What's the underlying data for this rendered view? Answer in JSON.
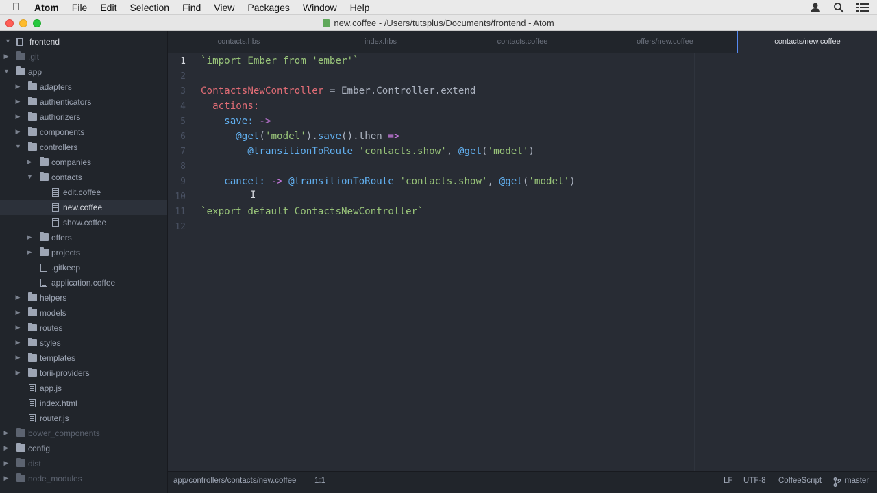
{
  "menubar": {
    "app_name": "Atom",
    "items": [
      "File",
      "Edit",
      "Selection",
      "Find",
      "View",
      "Packages",
      "Window",
      "Help"
    ]
  },
  "window": {
    "title": "new.coffee - /Users/tutsplus/Documents/frontend - Atom"
  },
  "tree": {
    "project": "frontend",
    "items": [
      {
        "label": ".git",
        "kind": "folder",
        "depth": 1,
        "expanded": false,
        "dim": true
      },
      {
        "label": "app",
        "kind": "folder",
        "depth": 1,
        "expanded": true
      },
      {
        "label": "adapters",
        "kind": "folder",
        "depth": 2,
        "expanded": false
      },
      {
        "label": "authenticators",
        "kind": "folder",
        "depth": 2,
        "expanded": false
      },
      {
        "label": "authorizers",
        "kind": "folder",
        "depth": 2,
        "expanded": false
      },
      {
        "label": "components",
        "kind": "folder",
        "depth": 2,
        "expanded": false
      },
      {
        "label": "controllers",
        "kind": "folder",
        "depth": 2,
        "expanded": true
      },
      {
        "label": "companies",
        "kind": "folder",
        "depth": 3,
        "expanded": false
      },
      {
        "label": "contacts",
        "kind": "folder",
        "depth": 3,
        "expanded": true
      },
      {
        "label": "edit.coffee",
        "kind": "file",
        "depth": 4
      },
      {
        "label": "new.coffee",
        "kind": "file",
        "depth": 4,
        "selected": true
      },
      {
        "label": "show.coffee",
        "kind": "file",
        "depth": 4
      },
      {
        "label": "offers",
        "kind": "folder",
        "depth": 3,
        "expanded": false
      },
      {
        "label": "projects",
        "kind": "folder",
        "depth": 3,
        "expanded": false
      },
      {
        "label": ".gitkeep",
        "kind": "file",
        "depth": 3
      },
      {
        "label": "application.coffee",
        "kind": "file",
        "depth": 3
      },
      {
        "label": "helpers",
        "kind": "folder",
        "depth": 2,
        "expanded": false
      },
      {
        "label": "models",
        "kind": "folder",
        "depth": 2,
        "expanded": false
      },
      {
        "label": "routes",
        "kind": "folder",
        "depth": 2,
        "expanded": false
      },
      {
        "label": "styles",
        "kind": "folder",
        "depth": 2,
        "expanded": false
      },
      {
        "label": "templates",
        "kind": "folder",
        "depth": 2,
        "expanded": false
      },
      {
        "label": "torii-providers",
        "kind": "folder",
        "depth": 2,
        "expanded": false
      },
      {
        "label": "app.js",
        "kind": "file",
        "depth": 2
      },
      {
        "label": "index.html",
        "kind": "file",
        "depth": 2
      },
      {
        "label": "router.js",
        "kind": "file",
        "depth": 2
      },
      {
        "label": "bower_components",
        "kind": "folder",
        "depth": 1,
        "expanded": false,
        "dim": true
      },
      {
        "label": "config",
        "kind": "folder",
        "depth": 1,
        "expanded": false
      },
      {
        "label": "dist",
        "kind": "folder",
        "depth": 1,
        "expanded": false,
        "dim": true
      },
      {
        "label": "node_modules",
        "kind": "folder",
        "depth": 1,
        "expanded": false,
        "dim": true
      }
    ]
  },
  "tabs": [
    {
      "label": "contacts.hbs",
      "active": false
    },
    {
      "label": "index.hbs",
      "active": false
    },
    {
      "label": "contacts.coffee",
      "active": false
    },
    {
      "label": "offers/new.coffee",
      "active": false
    },
    {
      "label": "contacts/new.coffee",
      "active": true
    }
  ],
  "editor": {
    "current_line": 1,
    "lines": [
      [
        [
          "`import Ember from 'ember'`",
          "emb"
        ]
      ],
      [],
      [
        [
          "ContactsNewController",
          "cls"
        ],
        [
          " = Ember.Controller.extend",
          "pl"
        ]
      ],
      [
        [
          "  actions:",
          "key"
        ]
      ],
      [
        [
          "    save:",
          "fn"
        ],
        [
          " ->",
          "op"
        ]
      ],
      [
        [
          "      @get",
          "fn"
        ],
        [
          "(",
          "pl"
        ],
        [
          "'model'",
          "str"
        ],
        [
          ").",
          "pl"
        ],
        [
          "save",
          "fn"
        ],
        [
          "().then ",
          "pl"
        ],
        [
          "=>",
          "op"
        ]
      ],
      [
        [
          "        @transitionToRoute",
          "fn"
        ],
        [
          " ",
          "pl"
        ],
        [
          "'contacts.show'",
          "str"
        ],
        [
          ", ",
          "pl"
        ],
        [
          "@get",
          "fn"
        ],
        [
          "(",
          "pl"
        ],
        [
          "'model'",
          "str"
        ],
        [
          ")",
          "pl"
        ]
      ],
      [],
      [
        [
          "    cancel:",
          "fn"
        ],
        [
          " ->",
          "op"
        ],
        [
          " ",
          "pl"
        ],
        [
          "@transitionToRoute",
          "fn"
        ],
        [
          " ",
          "pl"
        ],
        [
          "'contacts.show'",
          "str"
        ],
        [
          ", ",
          "pl"
        ],
        [
          "@get",
          "fn"
        ],
        [
          "(",
          "pl"
        ],
        [
          "'model'",
          "str"
        ],
        [
          ")",
          "pl"
        ]
      ],
      [],
      [
        [
          "`export default ContactsNewController`",
          "emb"
        ]
      ],
      []
    ]
  },
  "statusbar": {
    "path": "app/controllers/contacts/new.coffee",
    "position": "1:1",
    "line_ending": "LF",
    "encoding": "UTF-8",
    "grammar": "CoffeeScript",
    "branch": "master"
  },
  "colors": {
    "accent": "#568af2",
    "background": "#282c34",
    "panel": "#21252b"
  }
}
